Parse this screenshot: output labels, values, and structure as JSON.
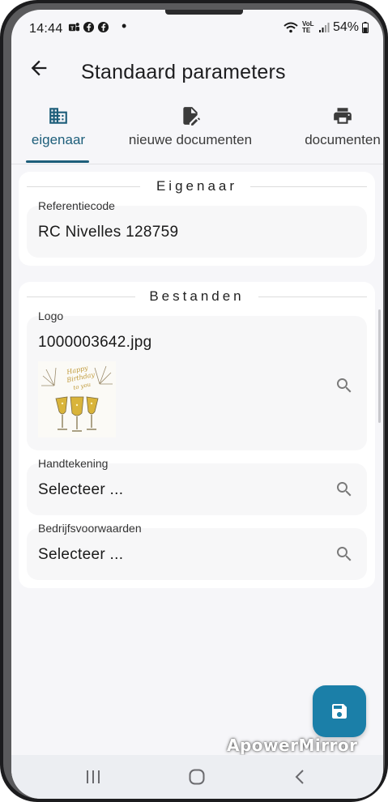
{
  "status_bar": {
    "time": "14:44",
    "battery": "54%",
    "icons_left": [
      "teams-icon",
      "facebook-icon",
      "facebook-icon"
    ],
    "notification_dot": "•",
    "network": "VoLTE"
  },
  "appbar": {
    "title": "Standaard parameters",
    "back_icon": "arrow-back-icon"
  },
  "tabs": [
    {
      "label": "eigenaar",
      "icon": "building-icon",
      "active": true
    },
    {
      "label": "nieuwe documenten",
      "icon": "edit-document-icon",
      "active": false
    },
    {
      "label": "documenten",
      "icon": "printer-icon",
      "active": false
    }
  ],
  "sections": {
    "owner": {
      "title": "Eigenaar",
      "reference": {
        "label": "Referentiecode",
        "value": "RC Nivelles 128759"
      }
    },
    "files": {
      "title": "Bestanden",
      "logo": {
        "label": "Logo",
        "value": "1000003642.jpg",
        "image_alt": "Happy Birthday to you"
      },
      "signature": {
        "label": "Handtekening",
        "value": "Selecteer ..."
      },
      "terms": {
        "label": "Bedrijfsvoorwaarden",
        "value": "Selecteer ..."
      }
    }
  },
  "fab": {
    "icon": "save-icon"
  },
  "watermark": "ApowerMirror",
  "colors": {
    "accent": "#1d5e7a",
    "fab": "#1b7fa8",
    "background": "#f6f6f9",
    "card": "#ffffff",
    "field": "#f7f7f8"
  }
}
